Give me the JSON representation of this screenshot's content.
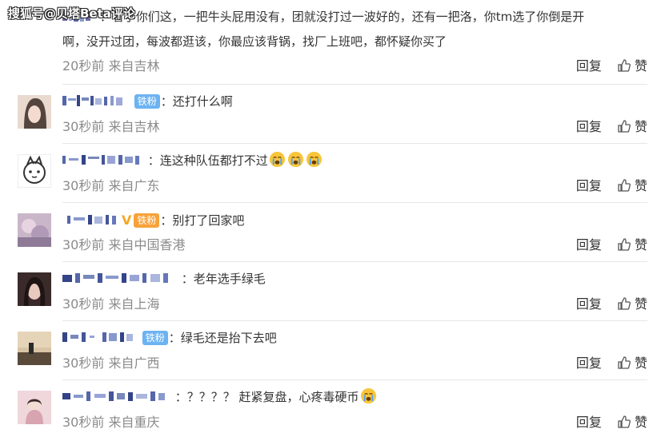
{
  "watermark": "搜狐号@贝塔Beta评论",
  "actions": {
    "reply_label": "回复",
    "like_label": "赞"
  },
  "comments": [
    {
      "name_masked": "▇▇▇",
      "text_line1": "：看了你们这，一把牛头屁用没有，团就没打过一波好的，还有一把洛，你tm选了你倒是开",
      "text_line2": "啊，没开过团，每波都逛该，你最应该背锅，找厂上班吧，都怀疑你买了",
      "time": "20秒前",
      "location": "来自吉林"
    },
    {
      "badge": "铁粉",
      "text": "：还打什么啊",
      "time": "30秒前",
      "location": "来自吉林"
    },
    {
      "text": "：连这种队伍都打不过",
      "emoji": "cry-emoji",
      "time": "30秒前",
      "location": "来自广东"
    },
    {
      "vip": "V",
      "badge": "铁粉",
      "text": "：别打了回家吧",
      "time": "30秒前",
      "location": "来自中国香港"
    },
    {
      "text": "：老年选手绿毛",
      "time": "30秒前",
      "location": "来自上海"
    },
    {
      "badge": "铁粉",
      "text": "：绿毛还是抬下去吧",
      "time": "30秒前",
      "location": "来自广西"
    },
    {
      "text": "：？？？？ 赶紧复盘，心疼毒硬币",
      "emoji": "cry-emoji",
      "time": "30秒前",
      "location": "来自重庆"
    }
  ]
}
